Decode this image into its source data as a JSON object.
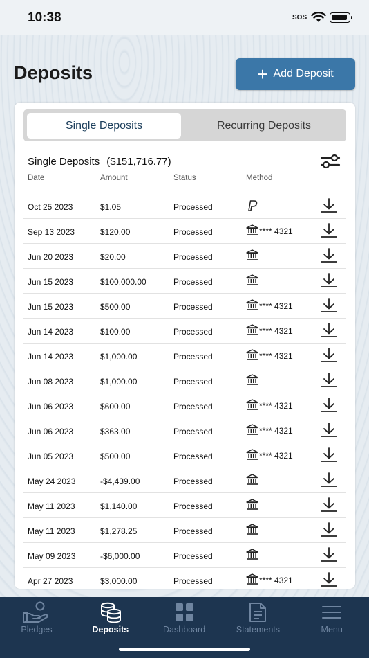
{
  "status_bar": {
    "time": "10:38",
    "sos": "SOS"
  },
  "page": {
    "title": "Deposits"
  },
  "add_button": {
    "label": "Add Deposit"
  },
  "segments": {
    "single": "Single Deposits",
    "recurring": "Recurring Deposits"
  },
  "section": {
    "title": "Single Deposits",
    "total": "($151,716.77)"
  },
  "columns": {
    "date": "Date",
    "amount": "Amount",
    "status": "Status",
    "method": "Method"
  },
  "rows": [
    {
      "date": "Oct 25 2023",
      "amount": "$1.05",
      "status": "Processed",
      "method_icon": "paypal-icon",
      "account": ""
    },
    {
      "date": "Sep 13 2023",
      "amount": "$120.00",
      "status": "Processed",
      "method_icon": "bank-icon",
      "account": "**** 4321"
    },
    {
      "date": "Jun 20 2023",
      "amount": "$20.00",
      "status": "Processed",
      "method_icon": "bank-icon",
      "account": ""
    },
    {
      "date": "Jun 15 2023",
      "amount": "$100,000.00",
      "status": "Processed",
      "method_icon": "bank-icon",
      "account": ""
    },
    {
      "date": "Jun 15 2023",
      "amount": "$500.00",
      "status": "Processed",
      "method_icon": "bank-icon",
      "account": "**** 4321"
    },
    {
      "date": "Jun 14 2023",
      "amount": "$100.00",
      "status": "Processed",
      "method_icon": "bank-icon",
      "account": "**** 4321"
    },
    {
      "date": "Jun 14 2023",
      "amount": "$1,000.00",
      "status": "Processed",
      "method_icon": "bank-icon",
      "account": "**** 4321"
    },
    {
      "date": "Jun 08 2023",
      "amount": "$1,000.00",
      "status": "Processed",
      "method_icon": "bank-icon",
      "account": ""
    },
    {
      "date": "Jun 06 2023",
      "amount": "$600.00",
      "status": "Processed",
      "method_icon": "bank-icon",
      "account": "**** 4321"
    },
    {
      "date": "Jun 06 2023",
      "amount": "$363.00",
      "status": "Processed",
      "method_icon": "bank-icon",
      "account": "**** 4321"
    },
    {
      "date": "Jun 05 2023",
      "amount": "$500.00",
      "status": "Processed",
      "method_icon": "bank-icon",
      "account": "**** 4321"
    },
    {
      "date": "May 24 2023",
      "amount": "-$4,439.00",
      "status": "Processed",
      "method_icon": "bank-icon",
      "account": ""
    },
    {
      "date": "May 11 2023",
      "amount": "$1,140.00",
      "status": "Processed",
      "method_icon": "bank-icon",
      "account": ""
    },
    {
      "date": "May 11 2023",
      "amount": "$1,278.25",
      "status": "Processed",
      "method_icon": "bank-icon",
      "account": ""
    },
    {
      "date": "May 09 2023",
      "amount": "-$6,000.00",
      "status": "Processed",
      "method_icon": "bank-icon",
      "account": ""
    },
    {
      "date": "Apr 27 2023",
      "amount": "$3,000.00",
      "status": "Processed",
      "method_icon": "bank-icon",
      "account": "**** 4321"
    }
  ],
  "tabbar": {
    "items": [
      {
        "label": "Pledges",
        "icon": "hand-coins-icon",
        "active": false
      },
      {
        "label": "Deposits",
        "icon": "coin-stack-icon",
        "active": true
      },
      {
        "label": "Dashboard",
        "icon": "grid-icon",
        "active": false
      },
      {
        "label": "Statements",
        "icon": "document-icon",
        "active": false
      },
      {
        "label": "Menu",
        "icon": "hamburger-icon",
        "active": false
      }
    ]
  },
  "colors": {
    "primary": "#3b77a8",
    "tabbar": "#1d3550",
    "tab_inactive": "#6f85a0"
  }
}
